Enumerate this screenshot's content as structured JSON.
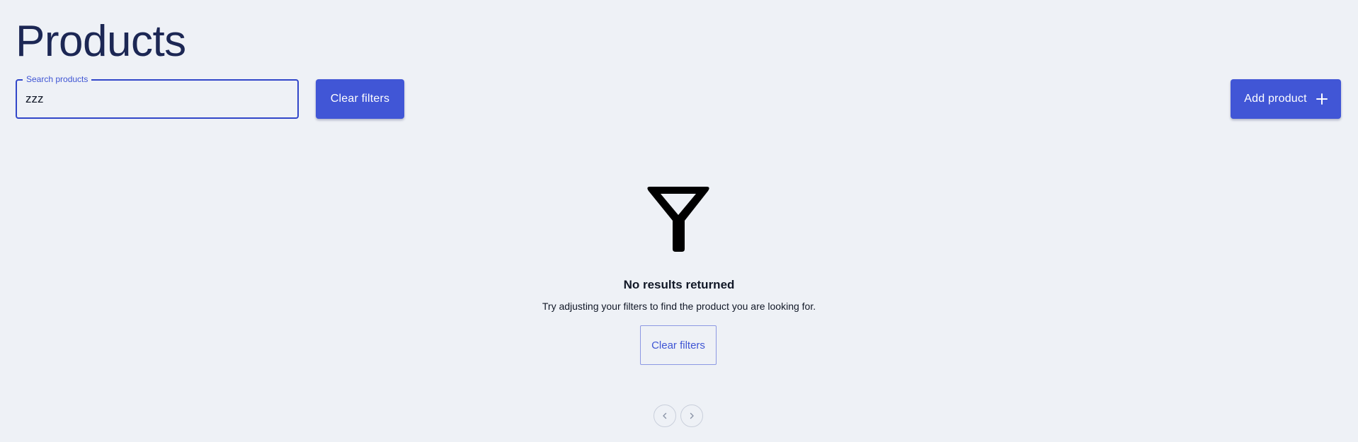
{
  "header": {
    "title": "Products"
  },
  "toolbar": {
    "search": {
      "label": "Search products",
      "value": "zzz"
    },
    "clear_filters_label": "Clear filters",
    "add_product_label": "Add product",
    "add_product_icon": "plus-icon"
  },
  "empty_state": {
    "icon": "filter-icon",
    "title": "No results returned",
    "message": "Try adjusting your filters to find the product you are looking for.",
    "clear_filters_label": "Clear filters"
  },
  "pagination": {
    "prev_icon": "chevron-left-icon",
    "next_icon": "chevron-right-icon"
  },
  "colors": {
    "background": "#eef1f6",
    "primary": "#4156d6",
    "title": "#1c2754"
  }
}
